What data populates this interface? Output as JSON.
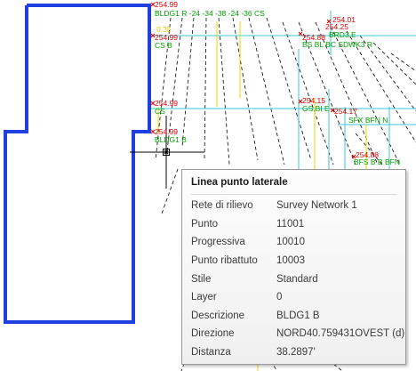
{
  "drawing": {
    "labels": [
      {
        "text": "254.99",
        "color": "red"
      },
      {
        "text": "BLDG1 R  -24  -34  -38  -24  -36 CS",
        "color": "green"
      },
      {
        "text": "0.35",
        "color": "yellow"
      },
      {
        "text": "254.99",
        "color": "red"
      },
      {
        "text": "CS B",
        "color": "green"
      },
      {
        "text": "254.01",
        "color": "red"
      },
      {
        "text": "254.25",
        "color": "red"
      },
      {
        "text": "BRD3 E",
        "color": "green"
      },
      {
        "text": "254.88",
        "color": "red"
      },
      {
        "text": "BS BL BC SDWK3 R",
        "color": "green"
      },
      {
        "text": "254.99",
        "color": "red"
      },
      {
        "text": "CS",
        "color": "green"
      },
      {
        "text": "254.15",
        "color": "red"
      },
      {
        "text": "254.17",
        "color": "red"
      },
      {
        "text": "GS BI E",
        "color": "green"
      },
      {
        "text": "SFX BFN N",
        "color": "green"
      },
      {
        "text": "254.99",
        "color": "red"
      },
      {
        "text": "BLDG1 B",
        "color": "green"
      },
      {
        "text": "254.88",
        "color": "red"
      },
      {
        "text": "BFS B  B  BFN",
        "color": "green"
      }
    ]
  },
  "tooltip": {
    "title": "Linea punto laterale",
    "rows": [
      {
        "key": "Rete di rilievo",
        "value": "Survey Network 1"
      },
      {
        "key": "Punto",
        "value": "11001"
      },
      {
        "key": "Progressiva",
        "value": "10010"
      },
      {
        "key": "Punto ribattuto",
        "value": "10003"
      },
      {
        "key": "Stile",
        "value": "Standard"
      },
      {
        "key": "Layer",
        "value": "0"
      },
      {
        "key": "Descrizione",
        "value": "BLDG1 B"
      },
      {
        "key": "Direzione",
        "value": "NORD40.759431OVEST (d)"
      },
      {
        "key": "Distanza",
        "value": "38.2897'"
      }
    ]
  },
  "colors": {
    "outline": "#1f3fe0",
    "cyan": "#37c7d6",
    "yellow": "#e0d000",
    "red": "#e00000",
    "green": "#00a000",
    "dashed": "#000000"
  }
}
